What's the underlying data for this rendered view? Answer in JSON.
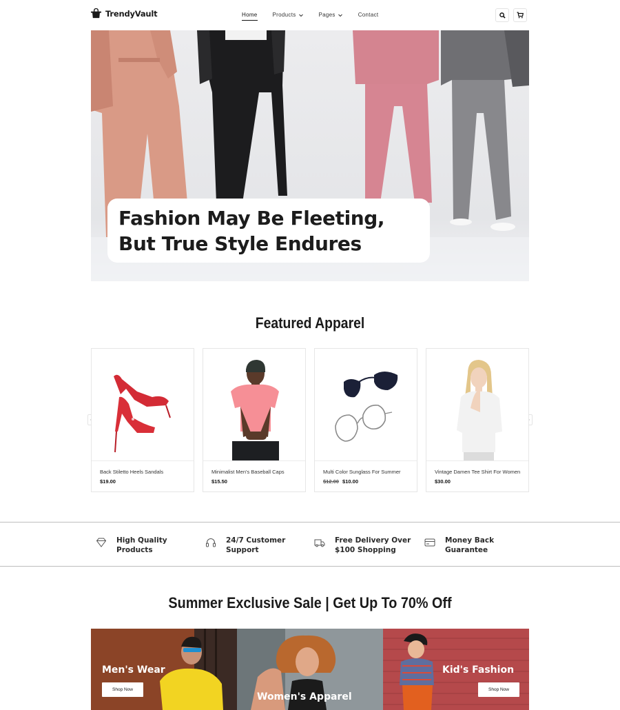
{
  "brand": {
    "name": "TrendyVault"
  },
  "nav": {
    "items": [
      {
        "label": "Home",
        "active": true,
        "dropdown": false
      },
      {
        "label": "Products",
        "active": false,
        "dropdown": true
      },
      {
        "label": "Pages",
        "active": false,
        "dropdown": true
      },
      {
        "label": "Contact",
        "active": false,
        "dropdown": false
      }
    ],
    "icons": [
      "search-icon",
      "cart-icon"
    ]
  },
  "hero": {
    "title_line1": "Fashion May Be Fleeting,",
    "title_line2": "But True Style Endures"
  },
  "featured": {
    "title": "Featured Apparel",
    "products": [
      {
        "name": "Back Stiletto Heels Sandals",
        "old_price": "",
        "price": "$19.00",
        "image": "red-heels"
      },
      {
        "name": "Minimalist Men's Baseball Caps",
        "old_price": "",
        "price": "$15.50",
        "image": "man-pink-shirt-cap"
      },
      {
        "name": "Multi Color Sunglass For Summer",
        "old_price": "$12.00",
        "price": "$10.00",
        "image": "sunglasses"
      },
      {
        "name": "Vintage Damen Tee Shirt For Women",
        "old_price": "",
        "price": "$30.00",
        "image": "woman-white-tee"
      }
    ]
  },
  "features": [
    {
      "line1": "High Quality",
      "line2": "Products",
      "icon": "diamond-icon"
    },
    {
      "line1": "24/7 Customer",
      "line2": "Support",
      "icon": "headset-icon"
    },
    {
      "line1": "Free Delivery Over",
      "line2": "$100 Shopping",
      "icon": "truck-icon"
    },
    {
      "line1": "Money Back",
      "line2": "Guarantee",
      "icon": "card-icon"
    }
  ],
  "sale": {
    "title": "Summer Exclusive Sale | Get Up To 70% Off",
    "categories": [
      {
        "label": "Men's Wear",
        "button": "Shop Now"
      },
      {
        "label": "Women's Apparel",
        "button": ""
      },
      {
        "label": "Kid's Fashion",
        "button": "Shop Now"
      }
    ]
  },
  "colors": {
    "accent": "#1a1a1a",
    "border": "#e6e6e6",
    "hero_bg": "#e9eaec"
  }
}
